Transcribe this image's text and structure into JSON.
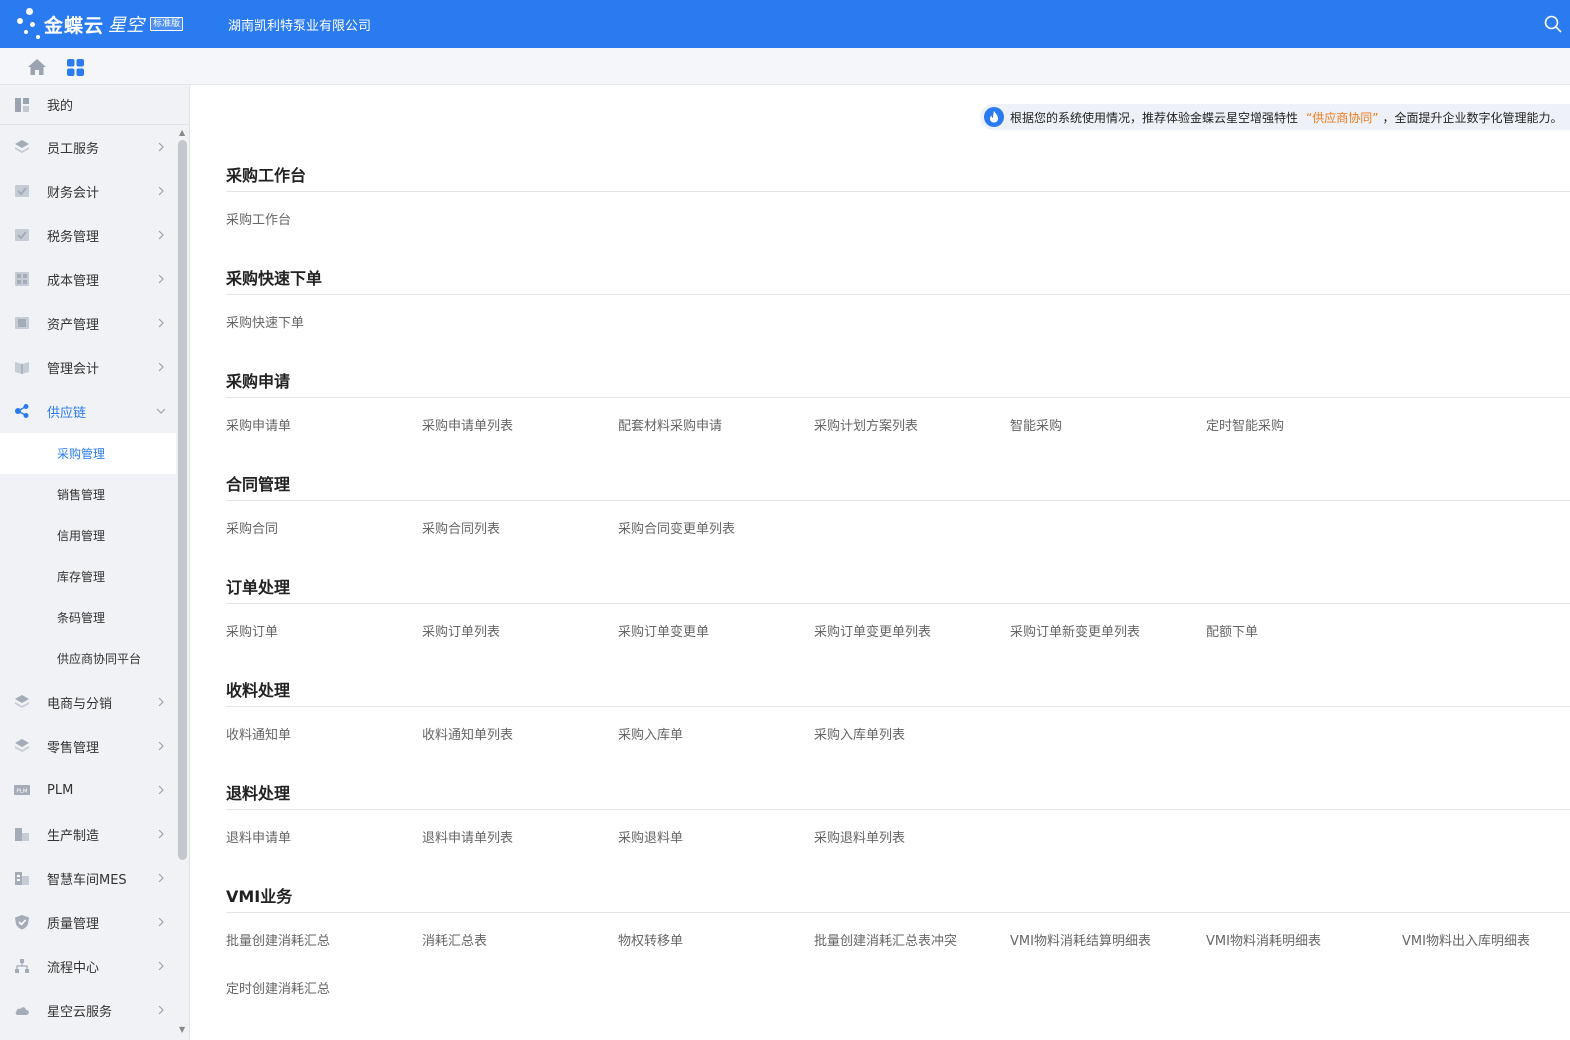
{
  "header": {
    "logo_main": "金蝶云",
    "logo_sub": "星空",
    "logo_badge": "标准版",
    "company": "湖南凯利特泵业有限公司"
  },
  "sidebar": {
    "my": "我的",
    "items": [
      {
        "label": "员工服务",
        "icon": "layers-icon"
      },
      {
        "label": "财务会计",
        "icon": "ledger-icon"
      },
      {
        "label": "税务管理",
        "icon": "tax-icon"
      },
      {
        "label": "成本管理",
        "icon": "calculator-icon"
      },
      {
        "label": "资产管理",
        "icon": "asset-icon"
      },
      {
        "label": "管理会计",
        "icon": "book-icon"
      },
      {
        "label": "供应链",
        "icon": "supply-chain-icon"
      }
    ],
    "sub_items": [
      {
        "label": "采购管理"
      },
      {
        "label": "销售管理"
      },
      {
        "label": "信用管理"
      },
      {
        "label": "库存管理"
      },
      {
        "label": "条码管理"
      },
      {
        "label": "供应商协同平台"
      }
    ],
    "items_after": [
      {
        "label": "电商与分销",
        "icon": "layers-icon"
      },
      {
        "label": "零售管理",
        "icon": "layers-icon"
      },
      {
        "label": "PLM",
        "icon": "plm-icon"
      },
      {
        "label": "生产制造",
        "icon": "factory-icon"
      },
      {
        "label": "智慧车间MES",
        "icon": "workshop-icon"
      },
      {
        "label": "质量管理",
        "icon": "shield-icon"
      },
      {
        "label": "流程中心",
        "icon": "flow-icon"
      },
      {
        "label": "星空云服务",
        "icon": "cloud-icon"
      }
    ]
  },
  "notice": {
    "before": "根据您的系统使用情况，推荐体验金蝶云星空增强特性",
    "highlight": "“供应商协同”",
    "after": "，全面提升企业数字化管理能力。"
  },
  "sections": [
    {
      "title": "采购工作台",
      "links": [
        "采购工作台"
      ]
    },
    {
      "title": "采购快速下单",
      "links": [
        "采购快速下单"
      ]
    },
    {
      "title": "采购申请",
      "links": [
        "采购申请单",
        "采购申请单列表",
        "配套材料采购申请",
        "采购计划方案列表",
        "智能采购",
        "定时智能采购"
      ]
    },
    {
      "title": "合同管理",
      "links": [
        "采购合同",
        "采购合同列表",
        "采购合同变更单列表"
      ]
    },
    {
      "title": "订单处理",
      "links": [
        "采购订单",
        "采购订单列表",
        "采购订单变更单",
        "采购订单变更单列表",
        "采购订单新变更单列表",
        "配额下单"
      ]
    },
    {
      "title": "收料处理",
      "links": [
        "收料通知单",
        "收料通知单列表",
        "采购入库单",
        "采购入库单列表"
      ]
    },
    {
      "title": "退料处理",
      "links": [
        "退料申请单",
        "退料申请单列表",
        "采购退料单",
        "采购退料单列表"
      ]
    },
    {
      "title": "VMI业务",
      "links": [
        "批量创建消耗汇总",
        "消耗汇总表",
        "物权转移单",
        "批量创建消耗汇总表冲突",
        "VMI物料消耗结算明细表",
        "VMI物料消耗明细表",
        "VMI物料出入库明细表",
        "定时创建消耗汇总"
      ]
    }
  ],
  "colors": {
    "primary": "#2b7bf0",
    "highlight": "#f27a1a"
  }
}
